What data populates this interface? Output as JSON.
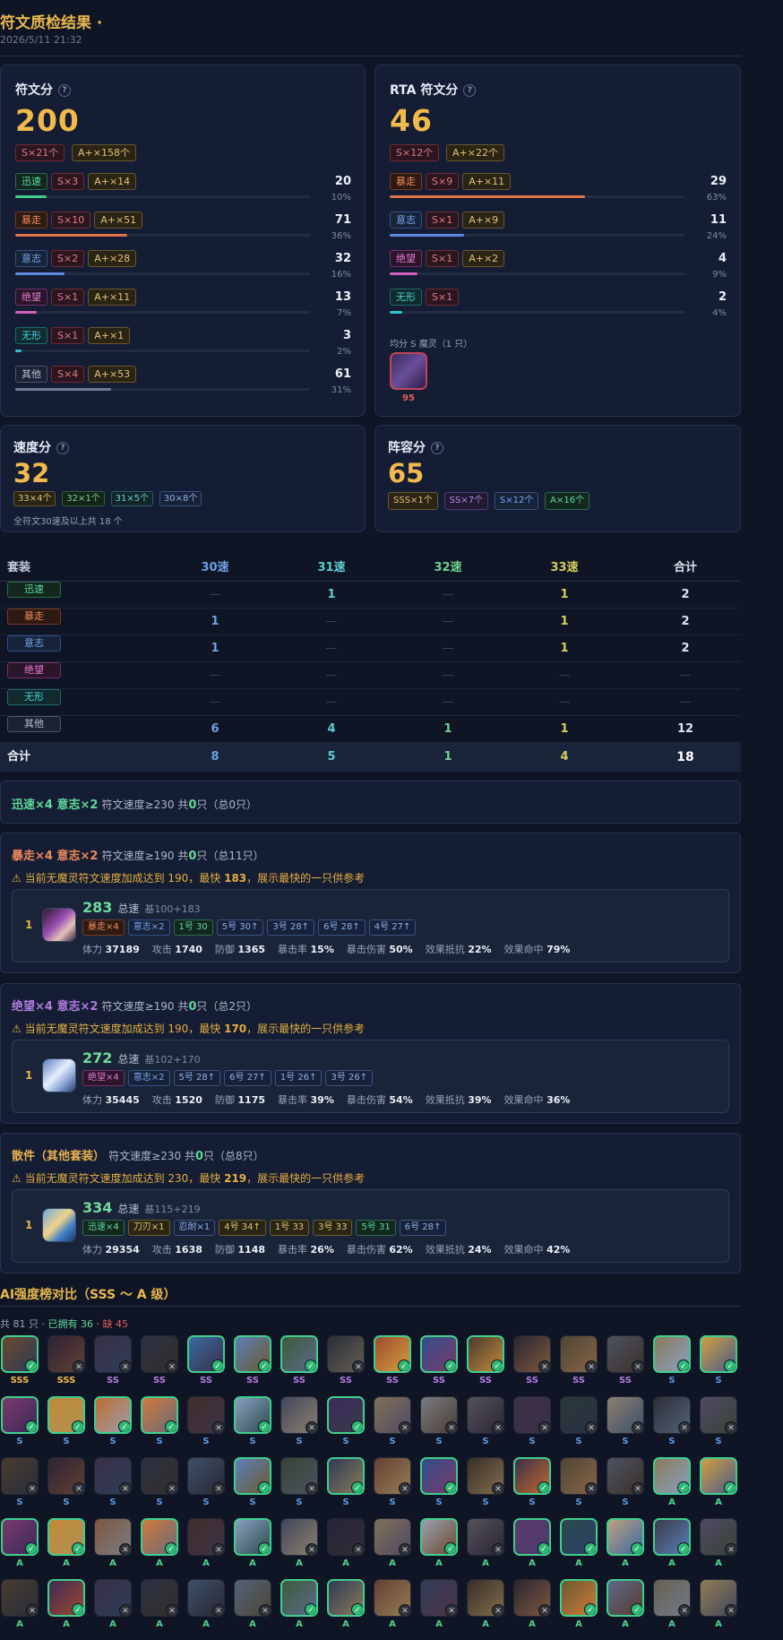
{
  "header": {
    "title": "符文质检结果 ·",
    "date": "2026/5/11 21:32"
  },
  "rune_score": {
    "title": "符文分",
    "help": "?",
    "value": "200",
    "summary": [
      "S×21个",
      "A+×158个"
    ],
    "rows": [
      {
        "set": "迅速",
        "s": "S×3",
        "a": "A+×14",
        "num": "20",
        "pct": "10%",
        "ratio": 0.1
      },
      {
        "set": "暴走",
        "s": "S×10",
        "a": "A+×51",
        "num": "71",
        "pct": "36%",
        "ratio": 0.36
      },
      {
        "set": "意志",
        "s": "S×2",
        "a": "A+×28",
        "num": "32",
        "pct": "16%",
        "ratio": 0.16
      },
      {
        "set": "绝望",
        "s": "S×1",
        "a": "A+×11",
        "num": "13",
        "pct": "7%",
        "ratio": 0.07
      },
      {
        "set": "无形",
        "s": "S×1",
        "a": "A+×1",
        "num": "3",
        "pct": "2%",
        "ratio": 0.02
      },
      {
        "set": "其他",
        "s": "S×4",
        "a": "A+×53",
        "num": "61",
        "pct": "31%",
        "ratio": 0.31
      }
    ]
  },
  "rta_score": {
    "title": "RTA 符文分",
    "help": "?",
    "value": "46",
    "summary": [
      "S×12个",
      "A+×22个"
    ],
    "rows": [
      {
        "set": "暴走",
        "s": "S×9",
        "a": "A+×11",
        "num": "29",
        "pct": "63%",
        "ratio": 0.63
      },
      {
        "set": "意志",
        "s": "S×1",
        "a": "A+×9",
        "num": "11",
        "pct": "24%",
        "ratio": 0.24
      },
      {
        "set": "绝望",
        "s": "S×1",
        "a": "A+×2",
        "num": "4",
        "pct": "9%",
        "ratio": 0.09
      },
      {
        "set": "无形",
        "s": "S×1",
        "a": "",
        "num": "2",
        "pct": "4%",
        "ratio": 0.04
      }
    ],
    "even_label": "均分 S 魔灵（1 只）",
    "even_value": "95"
  },
  "speed_score": {
    "title": "速度分",
    "help": "?",
    "value": "32",
    "chips": [
      "33×4个",
      "32×1个",
      "31×5个",
      "30×8个"
    ],
    "note": "全符文30速及以上共 18 个"
  },
  "team_score": {
    "title": "阵容分",
    "help": "?",
    "value": "65",
    "chips": [
      "SSS×1个",
      "SS×7个",
      "S×12个",
      "A×16个"
    ]
  },
  "table": {
    "headers": [
      "套装",
      "30速",
      "31速",
      "32速",
      "33速",
      "合计"
    ],
    "rows": [
      {
        "set": "迅速",
        "v": [
          "—",
          "1",
          "—",
          "1",
          "2"
        ]
      },
      {
        "set": "暴走",
        "v": [
          "1",
          "—",
          "—",
          "1",
          "2"
        ]
      },
      {
        "set": "意志",
        "v": [
          "1",
          "—",
          "—",
          "1",
          "2"
        ]
      },
      {
        "set": "绝望",
        "v": [
          "—",
          "—",
          "—",
          "—",
          "—"
        ]
      },
      {
        "set": "无形",
        "v": [
          "—",
          "—",
          "—",
          "—",
          "—"
        ]
      },
      {
        "set": "其他",
        "v": [
          "6",
          "4",
          "1",
          "1",
          "12"
        ]
      }
    ],
    "total": {
      "label": "合计",
      "v": [
        "8",
        "5",
        "1",
        "4",
        "18"
      ]
    }
  },
  "sets": [
    {
      "title": "迅速×4 意志×2",
      "desc": "符文速度≥230 共",
      "count": "0",
      "tail": "只（总0只）"
    },
    {
      "title": "暴走×4 意志×2",
      "desc": "符文速度≥190 共",
      "count": "0",
      "tail": "只（总11只）",
      "warn_pre": "⚠ 当前无魔灵符文速度加成达到 190，最快 ",
      "warn_val": "183",
      "warn_post": "，展示最快的一只供参考",
      "mon": {
        "rank": "1",
        "speed": "283",
        "speed_label": "总速",
        "base": "基100+183",
        "chips": [
          "暴走×4",
          "意志×2",
          "1号 30",
          "5号 30↑",
          "3号 28↑",
          "6号 28↑",
          "4号 27↑"
        ],
        "stats": [
          [
            "体力",
            "37189"
          ],
          [
            "攻击",
            "1740"
          ],
          [
            "防御",
            "1365"
          ],
          [
            "暴击率",
            "15%"
          ],
          [
            "暴击伤害",
            "50%"
          ],
          [
            "效果抵抗",
            "22%"
          ],
          [
            "效果命中",
            "79%"
          ]
        ]
      }
    },
    {
      "title": "绝望×4 意志×2",
      "desc": "符文速度≥190 共",
      "count": "0",
      "tail": "只（总2只）",
      "warn_pre": "⚠ 当前无魔灵符文速度加成达到 190，最快 ",
      "warn_val": "170",
      "warn_post": "，展示最快的一只供参考",
      "mon": {
        "rank": "1",
        "speed": "272",
        "speed_label": "总速",
        "base": "基102+170",
        "chips": [
          "绝望×4",
          "意志×2",
          "5号 28↑",
          "6号 27↑",
          "1号 26↑",
          "3号 26↑"
        ],
        "stats": [
          [
            "体力",
            "35445"
          ],
          [
            "攻击",
            "1520"
          ],
          [
            "防御",
            "1175"
          ],
          [
            "暴击率",
            "39%"
          ],
          [
            "暴击伤害",
            "54%"
          ],
          [
            "效果抵抗",
            "39%"
          ],
          [
            "效果命中",
            "36%"
          ]
        ]
      }
    },
    {
      "title": "散件（其他套装）",
      "desc": "符文速度≥230 共",
      "count": "0",
      "tail": "只（总8只）",
      "warn_pre": "⚠ 当前无魔灵符文速度加成达到 230，最快 ",
      "warn_val": "219",
      "warn_post": "，展示最快的一只供参考",
      "mon": {
        "rank": "1",
        "speed": "334",
        "speed_label": "总速",
        "base": "基115+219",
        "chips": [
          "迅速×4",
          "刀刃×1",
          "忍耐×1",
          "4号 34↑",
          "1号 33",
          "3号 33",
          "5号 31",
          "6号 28↑"
        ],
        "stats": [
          [
            "体力",
            "29354"
          ],
          [
            "攻击",
            "1638"
          ],
          [
            "防御",
            "1148"
          ],
          [
            "暴击率",
            "26%"
          ],
          [
            "暴击伤害",
            "62%"
          ],
          [
            "效果抵抗",
            "24%"
          ],
          [
            "效果命中",
            "42%"
          ]
        ]
      }
    }
  ],
  "ai_compare": {
    "title": "AI强度榜对比（SSS ～ A 级）",
    "count_pre": "共 81 只 · ",
    "owned": "已拥有 36",
    "sep": " · ",
    "missing": "缺 45",
    "rows": [
      {
        "tiers": [
          "SSS",
          "SSS",
          "SS",
          "SS",
          "SS",
          "SS",
          "SS",
          "SS",
          "SS",
          "SS",
          "SS",
          "SS",
          "SS",
          "SS",
          "S",
          "S"
        ],
        "owned": [
          1,
          0,
          0,
          0,
          1,
          1,
          1,
          0,
          1,
          1,
          1,
          0,
          0,
          0,
          1,
          1
        ]
      },
      {
        "tiers": [
          "S",
          "S",
          "S",
          "S",
          "S",
          "S",
          "S",
          "S",
          "S",
          "S",
          "S",
          "S",
          "S",
          "S",
          "S",
          "S"
        ],
        "owned": [
          1,
          1,
          1,
          1,
          0,
          1,
          0,
          1,
          0,
          0,
          0,
          0,
          0,
          0,
          0,
          0
        ]
      },
      {
        "tiers": [
          "S",
          "S",
          "S",
          "S",
          "S",
          "S",
          "S",
          "S",
          "S",
          "S",
          "S",
          "S",
          "S",
          "S",
          "A",
          "A"
        ],
        "owned": [
          0,
          0,
          0,
          0,
          0,
          1,
          0,
          1,
          0,
          1,
          0,
          1,
          0,
          0,
          1,
          1
        ]
      },
      {
        "tiers": [
          "A",
          "A",
          "A",
          "A",
          "A",
          "A",
          "A",
          "A",
          "A",
          "A",
          "A",
          "A",
          "A",
          "A",
          "A",
          "A"
        ],
        "owned": [
          1,
          1,
          0,
          1,
          0,
          1,
          0,
          0,
          0,
          1,
          0,
          1,
          1,
          1,
          1,
          0
        ]
      },
      {
        "tiers": [
          "A",
          "A",
          "A",
          "A",
          "A",
          "A",
          "A",
          "A",
          "A",
          "A",
          "A",
          "A",
          "A",
          "A",
          "A",
          "A"
        ],
        "owned": [
          0,
          1,
          0,
          0,
          0,
          0,
          1,
          1,
          0,
          0,
          0,
          0,
          1,
          1,
          0,
          0
        ]
      }
    ]
  },
  "colors": {
    "gold": "#f2b94c",
    "green": "#5ddb9c",
    "red": "#e45c5c",
    "bg": "#0f1524"
  }
}
